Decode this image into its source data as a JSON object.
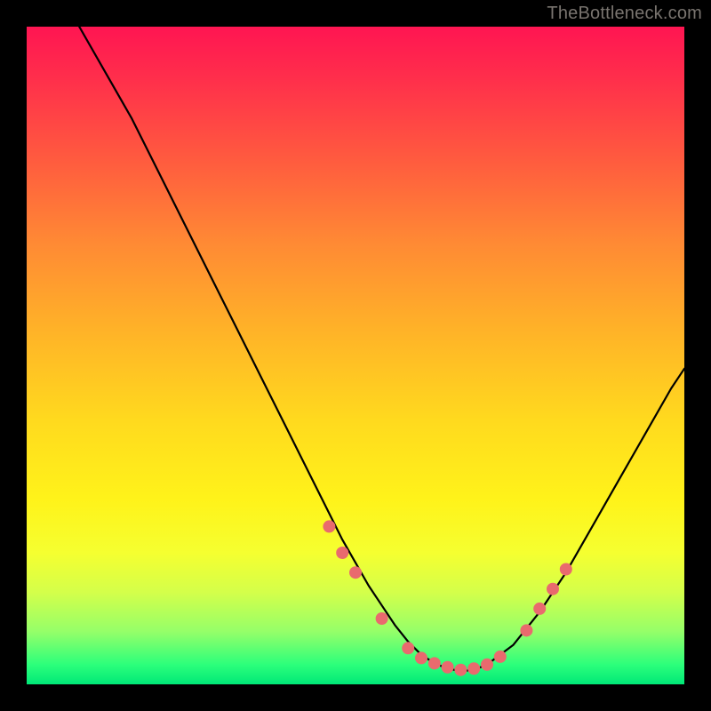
{
  "attribution": "TheBottleneck.com",
  "chart_data": {
    "type": "line",
    "title": "",
    "xlabel": "",
    "ylabel": "",
    "xlim": [
      0,
      100
    ],
    "ylim": [
      0,
      100
    ],
    "curve": {
      "name": "bottleneck-curve",
      "x": [
        8,
        12,
        16,
        20,
        24,
        28,
        32,
        36,
        40,
        44,
        48,
        52,
        54,
        56,
        58,
        60,
        62,
        64,
        66,
        68,
        70,
        74,
        78,
        82,
        86,
        90,
        94,
        98,
        100
      ],
      "y": [
        100,
        93,
        86,
        78,
        70,
        62,
        54,
        46,
        38,
        30,
        22,
        15,
        12,
        9,
        6.5,
        4.5,
        3.2,
        2.4,
        2.0,
        2.2,
        3.0,
        6.0,
        11,
        17,
        24,
        31,
        38,
        45,
        48
      ]
    },
    "markers": {
      "name": "highlight-dots",
      "color": "#e96a6e",
      "radius": 7,
      "x": [
        46,
        48,
        50,
        54,
        58,
        60,
        62,
        64,
        66,
        68,
        70,
        72,
        76,
        78,
        80,
        82
      ],
      "y": [
        24,
        20,
        17,
        10,
        5.5,
        4.0,
        3.2,
        2.6,
        2.2,
        2.4,
        3.0,
        4.2,
        8.2,
        11.5,
        14.5,
        17.5
      ]
    },
    "gradient_stops": [
      {
        "pos": 0.0,
        "color": "#ff1552"
      },
      {
        "pos": 0.6,
        "color": "#ffda1e"
      },
      {
        "pos": 0.86,
        "color": "#d4ff4a"
      },
      {
        "pos": 1.0,
        "color": "#00e877"
      }
    ]
  }
}
